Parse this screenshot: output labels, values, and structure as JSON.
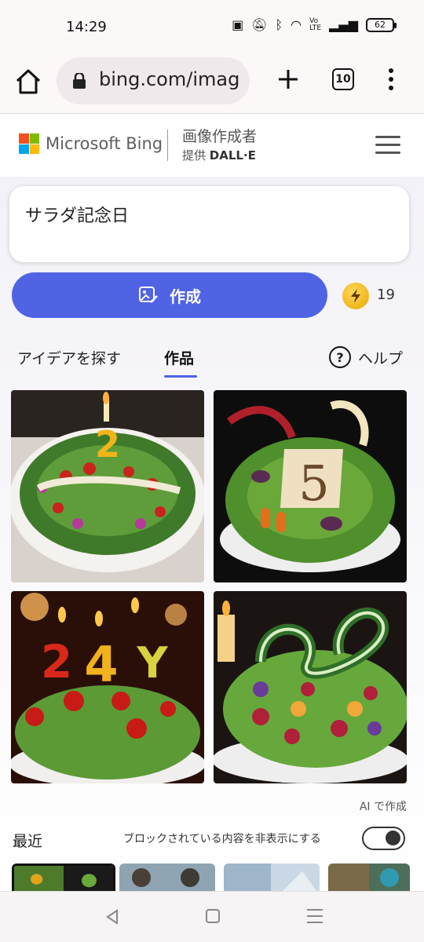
{
  "status": {
    "time": "14:29",
    "battery": "62",
    "icons": [
      "nfc-icon",
      "mute-icon",
      "bluetooth-icon",
      "wifi-icon",
      "volte-icon",
      "signal-icon",
      "battery-icon"
    ]
  },
  "browser": {
    "url": "bing.com/imag",
    "tab_count": "10"
  },
  "header": {
    "brand": "Microsoft Bing",
    "title": "画像作成者",
    "subtitle_prefix": "提供",
    "subtitle_brand": "DALL·E"
  },
  "prompt": {
    "text": "サラダ記念日"
  },
  "create_button": {
    "label": "作成"
  },
  "boosts": {
    "count": "19"
  },
  "tabs": {
    "explore": "アイデアを探す",
    "works": "作品",
    "help": "ヘルプ"
  },
  "results": {
    "ai_label": "AI で作成"
  },
  "recent": {
    "label": "最近",
    "hide_blocked_label": "ブロックされている内容を非表示にする",
    "hide_blocked_on": true
  },
  "colors": {
    "accent": "#4f63e4",
    "ms_red": "#f25022",
    "ms_green": "#7fba00",
    "ms_blue": "#00a4ef",
    "ms_yellow": "#ffb900"
  }
}
